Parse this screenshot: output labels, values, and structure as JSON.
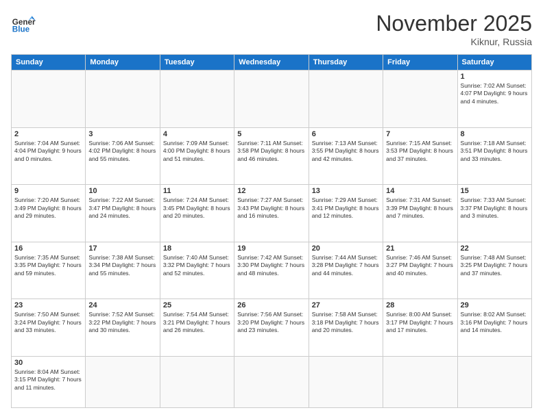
{
  "header": {
    "logo_general": "General",
    "logo_blue": "Blue",
    "month_title": "November 2025",
    "location": "Kiknur, Russia"
  },
  "days_of_week": [
    "Sunday",
    "Monday",
    "Tuesday",
    "Wednesday",
    "Thursday",
    "Friday",
    "Saturday"
  ],
  "weeks": [
    [
      {
        "day": "",
        "info": ""
      },
      {
        "day": "",
        "info": ""
      },
      {
        "day": "",
        "info": ""
      },
      {
        "day": "",
        "info": ""
      },
      {
        "day": "",
        "info": ""
      },
      {
        "day": "",
        "info": ""
      },
      {
        "day": "1",
        "info": "Sunrise: 7:02 AM\nSunset: 4:07 PM\nDaylight: 9 hours and 4 minutes."
      }
    ],
    [
      {
        "day": "2",
        "info": "Sunrise: 7:04 AM\nSunset: 4:04 PM\nDaylight: 9 hours and 0 minutes."
      },
      {
        "day": "3",
        "info": "Sunrise: 7:06 AM\nSunset: 4:02 PM\nDaylight: 8 hours and 55 minutes."
      },
      {
        "day": "4",
        "info": "Sunrise: 7:09 AM\nSunset: 4:00 PM\nDaylight: 8 hours and 51 minutes."
      },
      {
        "day": "5",
        "info": "Sunrise: 7:11 AM\nSunset: 3:58 PM\nDaylight: 8 hours and 46 minutes."
      },
      {
        "day": "6",
        "info": "Sunrise: 7:13 AM\nSunset: 3:55 PM\nDaylight: 8 hours and 42 minutes."
      },
      {
        "day": "7",
        "info": "Sunrise: 7:15 AM\nSunset: 3:53 PM\nDaylight: 8 hours and 37 minutes."
      },
      {
        "day": "8",
        "info": "Sunrise: 7:18 AM\nSunset: 3:51 PM\nDaylight: 8 hours and 33 minutes."
      }
    ],
    [
      {
        "day": "9",
        "info": "Sunrise: 7:20 AM\nSunset: 3:49 PM\nDaylight: 8 hours and 29 minutes."
      },
      {
        "day": "10",
        "info": "Sunrise: 7:22 AM\nSunset: 3:47 PM\nDaylight: 8 hours and 24 minutes."
      },
      {
        "day": "11",
        "info": "Sunrise: 7:24 AM\nSunset: 3:45 PM\nDaylight: 8 hours and 20 minutes."
      },
      {
        "day": "12",
        "info": "Sunrise: 7:27 AM\nSunset: 3:43 PM\nDaylight: 8 hours and 16 minutes."
      },
      {
        "day": "13",
        "info": "Sunrise: 7:29 AM\nSunset: 3:41 PM\nDaylight: 8 hours and 12 minutes."
      },
      {
        "day": "14",
        "info": "Sunrise: 7:31 AM\nSunset: 3:39 PM\nDaylight: 8 hours and 7 minutes."
      },
      {
        "day": "15",
        "info": "Sunrise: 7:33 AM\nSunset: 3:37 PM\nDaylight: 8 hours and 3 minutes."
      }
    ],
    [
      {
        "day": "16",
        "info": "Sunrise: 7:35 AM\nSunset: 3:35 PM\nDaylight: 7 hours and 59 minutes."
      },
      {
        "day": "17",
        "info": "Sunrise: 7:38 AM\nSunset: 3:34 PM\nDaylight: 7 hours and 55 minutes."
      },
      {
        "day": "18",
        "info": "Sunrise: 7:40 AM\nSunset: 3:32 PM\nDaylight: 7 hours and 52 minutes."
      },
      {
        "day": "19",
        "info": "Sunrise: 7:42 AM\nSunset: 3:30 PM\nDaylight: 7 hours and 48 minutes."
      },
      {
        "day": "20",
        "info": "Sunrise: 7:44 AM\nSunset: 3:28 PM\nDaylight: 7 hours and 44 minutes."
      },
      {
        "day": "21",
        "info": "Sunrise: 7:46 AM\nSunset: 3:27 PM\nDaylight: 7 hours and 40 minutes."
      },
      {
        "day": "22",
        "info": "Sunrise: 7:48 AM\nSunset: 3:25 PM\nDaylight: 7 hours and 37 minutes."
      }
    ],
    [
      {
        "day": "23",
        "info": "Sunrise: 7:50 AM\nSunset: 3:24 PM\nDaylight: 7 hours and 33 minutes."
      },
      {
        "day": "24",
        "info": "Sunrise: 7:52 AM\nSunset: 3:22 PM\nDaylight: 7 hours and 30 minutes."
      },
      {
        "day": "25",
        "info": "Sunrise: 7:54 AM\nSunset: 3:21 PM\nDaylight: 7 hours and 26 minutes."
      },
      {
        "day": "26",
        "info": "Sunrise: 7:56 AM\nSunset: 3:20 PM\nDaylight: 7 hours and 23 minutes."
      },
      {
        "day": "27",
        "info": "Sunrise: 7:58 AM\nSunset: 3:18 PM\nDaylight: 7 hours and 20 minutes."
      },
      {
        "day": "28",
        "info": "Sunrise: 8:00 AM\nSunset: 3:17 PM\nDaylight: 7 hours and 17 minutes."
      },
      {
        "day": "29",
        "info": "Sunrise: 8:02 AM\nSunset: 3:16 PM\nDaylight: 7 hours and 14 minutes."
      }
    ],
    [
      {
        "day": "30",
        "info": "Sunrise: 8:04 AM\nSunset: 3:15 PM\nDaylight: 7 hours and 11 minutes."
      },
      {
        "day": "",
        "info": ""
      },
      {
        "day": "",
        "info": ""
      },
      {
        "day": "",
        "info": ""
      },
      {
        "day": "",
        "info": ""
      },
      {
        "day": "",
        "info": ""
      },
      {
        "day": "",
        "info": ""
      }
    ]
  ]
}
